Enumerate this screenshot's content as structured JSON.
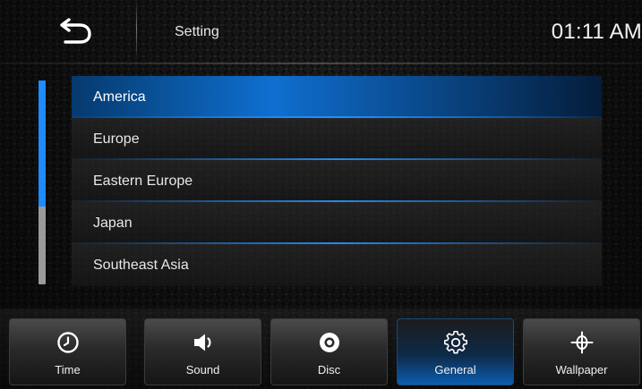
{
  "header": {
    "title": "Setting",
    "time": "01:11 AM"
  },
  "list": {
    "items": [
      {
        "label": "America",
        "selected": true
      },
      {
        "label": "Europe",
        "selected": false
      },
      {
        "label": "Eastern Europe",
        "selected": false
      },
      {
        "label": "Japan",
        "selected": false
      },
      {
        "label": "Southeast Asia",
        "selected": false
      }
    ],
    "scroll_fraction_visible": 0.62
  },
  "nav": {
    "time_label": "Time",
    "sound_label": "Sound",
    "disc_label": "Disc",
    "general_label": "General",
    "wallpaper_label": "Wallpaper",
    "active": "General"
  },
  "icons": {
    "back": "back-arrow-icon",
    "time": "clock-icon",
    "sound": "speaker-icon",
    "disc": "disc-icon",
    "general": "gear-icon",
    "wallpaper": "wallpaper-icon"
  },
  "colors": {
    "accent": "#1e8bff",
    "selected_row": "#0f6fd0",
    "text": "#e8e8e8"
  }
}
